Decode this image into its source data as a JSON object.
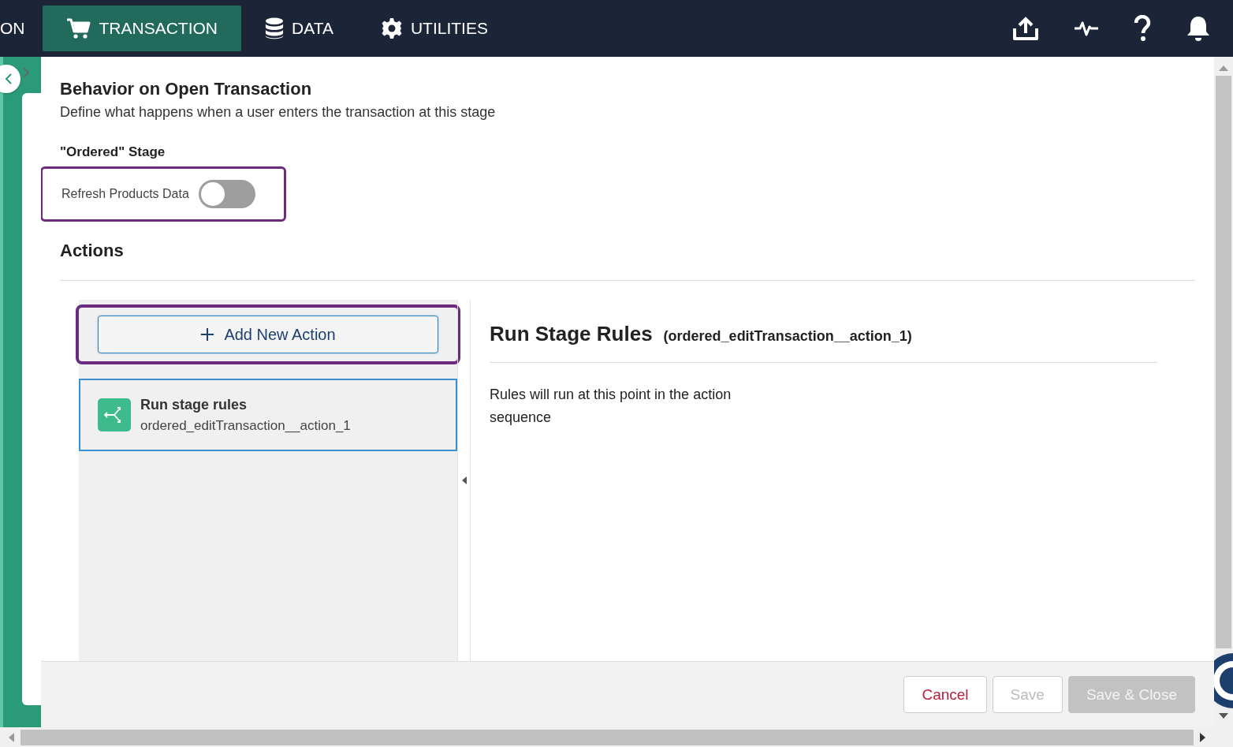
{
  "nav": {
    "items": [
      {
        "label": "ON",
        "selected": false
      },
      {
        "label": "TRANSACTION",
        "selected": true
      },
      {
        "label": "DATA",
        "selected": false
      },
      {
        "label": "UTILITIES",
        "selected": false
      }
    ]
  },
  "header": {
    "title": "Behavior on Open Transaction",
    "subtitle": "Define what happens when a user enters the transaction at this stage"
  },
  "stage": {
    "label": "\"Ordered\" Stage",
    "toggle": {
      "label": "Refresh Products Data",
      "on": false,
      "highlighted": true
    }
  },
  "actions": {
    "heading": "Actions",
    "add_button": {
      "label": "Add New Action",
      "highlighted": true
    },
    "items": [
      {
        "title": "Run stage rules",
        "id": "ordered_editTransaction__action_1",
        "selected": true
      }
    ]
  },
  "detail": {
    "title": "Run Stage Rules",
    "id": "(ordered_editTransaction__action_1)",
    "description": "Rules will run at this point in the action sequence"
  },
  "footer": {
    "buttons": [
      {
        "label": "Cancel",
        "kind": "cancel",
        "disabled": false
      },
      {
        "label": "Save",
        "kind": "secondary",
        "disabled": true
      },
      {
        "label": "Save & Close",
        "kind": "primary",
        "disabled": true
      }
    ]
  }
}
